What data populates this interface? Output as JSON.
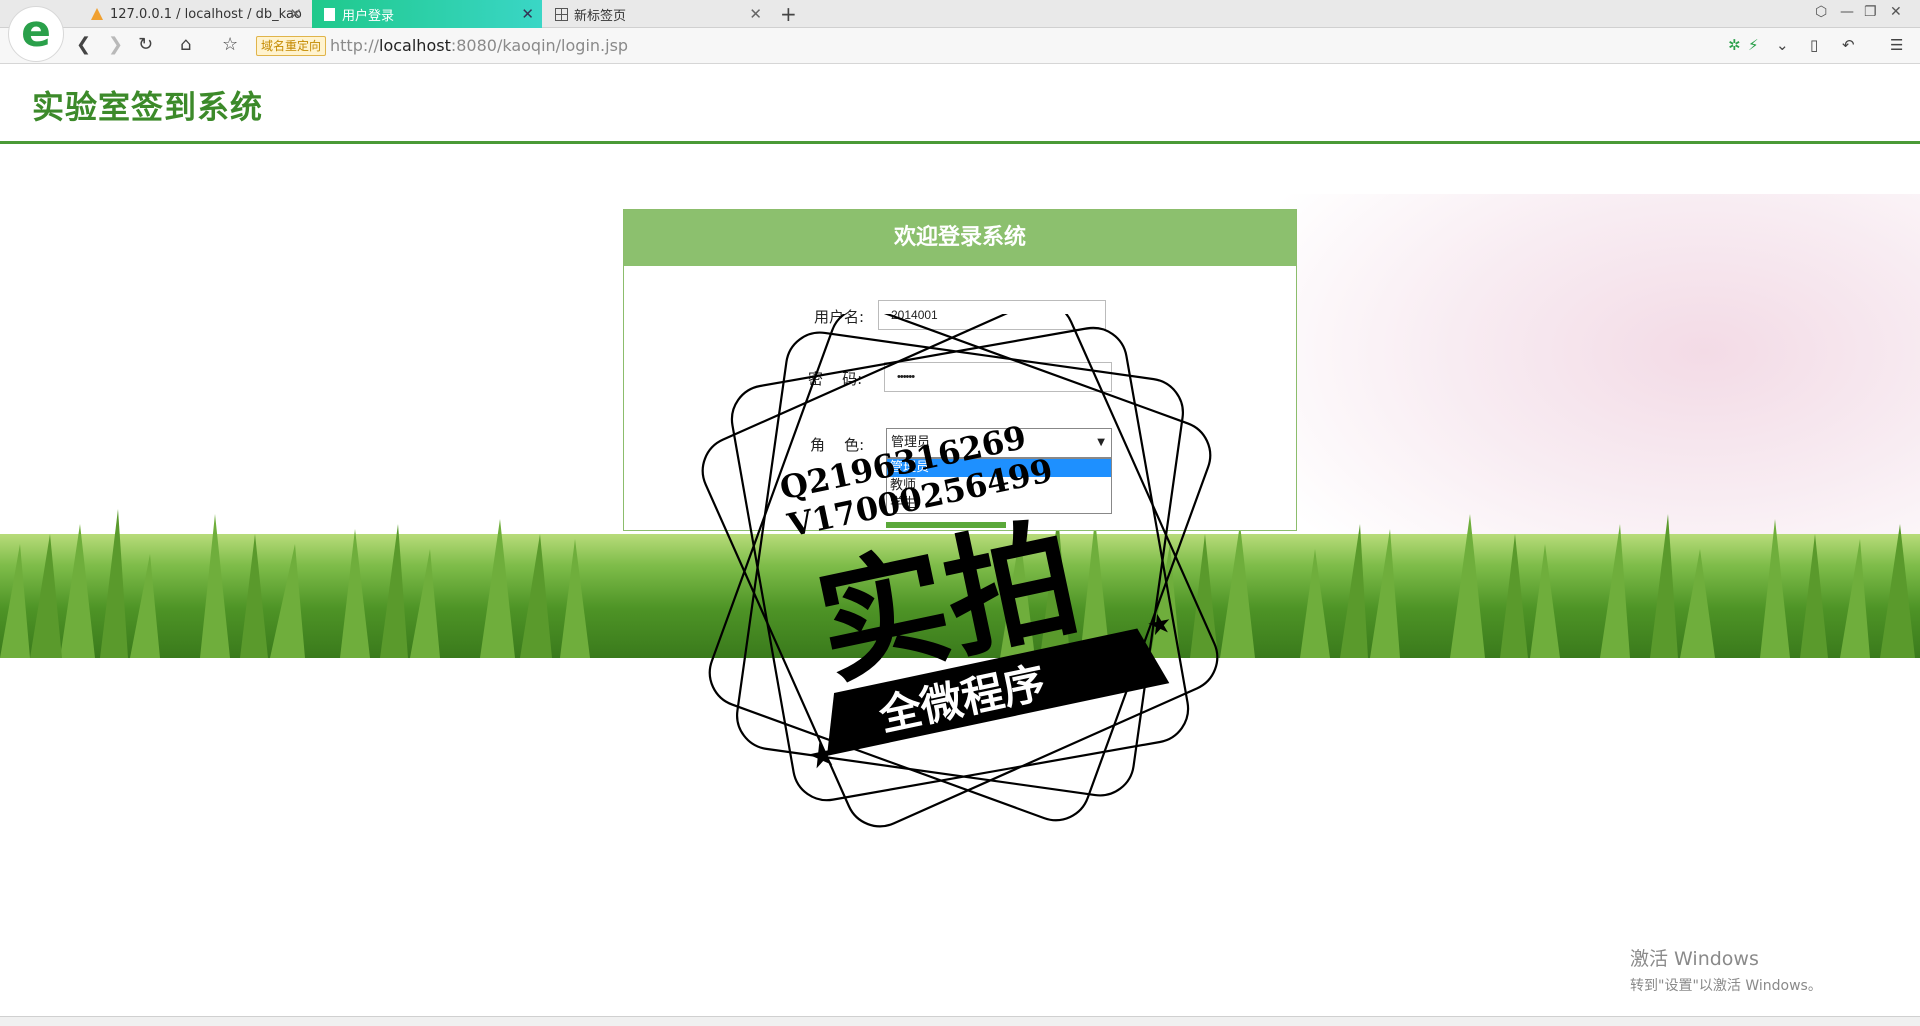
{
  "browser": {
    "tabs": [
      {
        "title": "127.0.0.1 / localhost / db_kao",
        "icon": "pma-icon"
      },
      {
        "title": "用户登录",
        "icon": "page-icon"
      },
      {
        "title": "新标签页",
        "icon": "grid-icon"
      }
    ],
    "redirect_badge": "域名重定向",
    "url_prefix": "http://",
    "url_host": "localhost",
    "url_rest": ":8080/kaoqin/login.jsp"
  },
  "site": {
    "title": "实验室签到系统"
  },
  "login": {
    "heading": "欢迎登录系统",
    "username_label": "用户名:",
    "username_value": "2014001",
    "password_label": "密    码:",
    "password_value": "••••••",
    "role_label": "角    色:",
    "role_selected": "管理员",
    "role_options": [
      "管理员",
      "教师",
      "学生"
    ]
  },
  "watermark": {
    "line1": "Q2196316269",
    "line2": "V17000256499",
    "main": "实拍",
    "banner": "全微程序"
  },
  "system": {
    "activation_title": "激活 Windows",
    "activation_sub": "转到\"设置\"以激活 Windows。"
  },
  "colors": {
    "accent_green": "#3c8a2a",
    "login_header": "#8cc06e",
    "active_tab": "#1fc98b"
  }
}
